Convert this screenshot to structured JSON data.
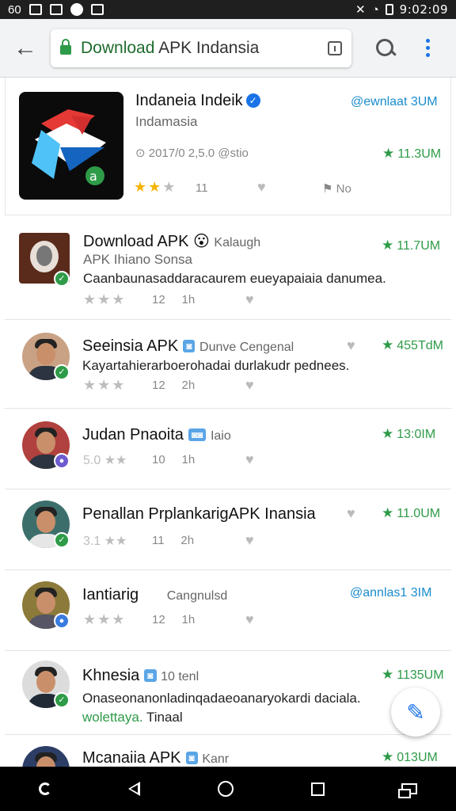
{
  "status_bar": {
    "left_text": "60",
    "time": "9:02:09"
  },
  "browser": {
    "url_highlight": "Download",
    "url_rest": " APK Indansia"
  },
  "hero": {
    "title": "Indaneia Indeik",
    "subtitle": "Indamasia",
    "meta": "⊙ 2017/0 2,5.0 @stio",
    "link": "@ewnlaat 3UM",
    "rating": "11.3UM",
    "stars": {
      "on": 2,
      "off": 2
    },
    "count": "11",
    "tag": "No"
  },
  "items": [
    {
      "title": "Download APK",
      "emoji": "😮",
      "extra": "Kalaugh",
      "subtitle": "APK Ihiano Sonsa",
      "desc": "Caanbaunasaddaracaurem eueyapaiaia danumea.",
      "rating": "11.7UM",
      "stars_text": "★★★",
      "count": "12",
      "age": "1h",
      "badge_color": "green"
    },
    {
      "title": "Seeinsia APK",
      "chip": "◙",
      "extra": "Dunve Cengenal",
      "desc": "Kayartahierarboerohadai durlakudr pednees.",
      "rating": "455TdM",
      "stars_text": "★★★",
      "count": "12",
      "age": "2h",
      "badge_color": "green"
    },
    {
      "title": "Judan Pnaoita",
      "chip": "◙◙",
      "extra": "Iaio",
      "rating": "13:0IM",
      "stars_text": "5.0 ★★",
      "count": "10",
      "age": "1h",
      "badge_color": "purple"
    },
    {
      "title": "Penallan PrplankarigAPK Inansia",
      "rating": "11.0UM",
      "stars_text": "3.1 ★★",
      "count": "11",
      "age": "2h",
      "badge_color": "green"
    },
    {
      "title": "Iantiarig",
      "extra": "Cangnulsd",
      "link": "@annlas1 3IM",
      "stars_text": "★★★",
      "count": "12",
      "age": "1h",
      "badge_color": "blue"
    },
    {
      "title": "Khnesia",
      "chip": "◙",
      "extra": "10 tenl",
      "rating": "1135UM",
      "desc": "Onaseonanonladinqadaeoanaryokardi daciala.",
      "desc2": "wolettaya.",
      "desc2b": "Tinaal",
      "badge_color": "green"
    },
    {
      "title": "Mcanaiia APK",
      "chip": "◙",
      "extra": "Kanr",
      "rating": "013UM"
    }
  ],
  "colors": {
    "accent": "#1a73e8",
    "green": "#2e9b48",
    "link": "#1a8ccd"
  },
  "icons": [
    "back-arrow-icon",
    "lock-icon",
    "info-icon",
    "search-icon",
    "overflow-menu-icon",
    "edit-pencil-icon",
    "back-nav-icon",
    "home-nav-icon",
    "recents-nav-icon"
  ]
}
